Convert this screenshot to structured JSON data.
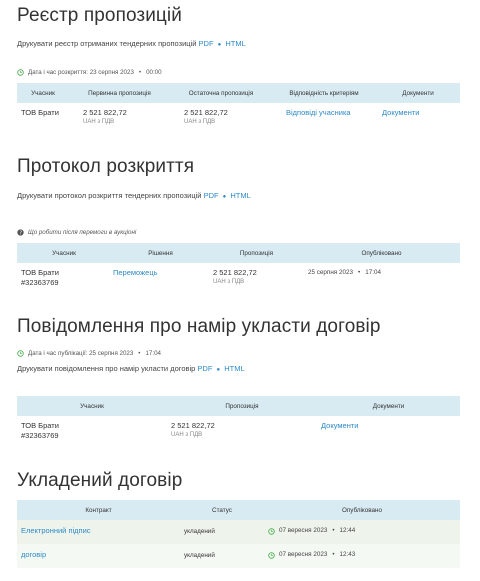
{
  "registry": {
    "title": "Реєстр пропозицій",
    "print_text": "Друкувати реєстр отриманих тендерних пропозицій",
    "pdf": "PDF",
    "html": "HTML",
    "opened_label": "Дата і час розкриття: 23 серпня 2023",
    "opened_time": "00:00",
    "columns": [
      "Учасник",
      "Первинна пропозиція",
      "Остаточна пропозиція",
      "Відповідність критеріям",
      "Документи"
    ],
    "rows": [
      {
        "participant": "ТОВ Брати",
        "initial": "2 521 822,72",
        "initial_sub": "UAH з ПДВ",
        "final": "2 521 822,72",
        "final_sub": "UAH з ПДВ",
        "criteria": "Відповіді учасника",
        "docs": "Документи"
      }
    ]
  },
  "protocol": {
    "title": "Протокол розкриття",
    "print_text": "Друкувати протокол розкриття тендерних пропозицій",
    "pdf": "PDF",
    "html": "HTML",
    "help_text": "Що робити після перемоги в аукціоні",
    "columns": [
      "Учасник",
      "Рішення",
      "Пропозиція",
      "Опубліковано"
    ],
    "rows": [
      {
        "participant": "ТОВ Брати",
        "participant_id": "#32363769",
        "decision": "Переможець",
        "offer": "2 521 822,72",
        "offer_sub": "UAH з ПДВ",
        "published_date": "25 серпня 2023",
        "published_time": "17:04"
      }
    ]
  },
  "intent": {
    "title": "Повідомлення про намір укласти договір",
    "pub_label": "Дата і час публікації: 25 серпня 2023",
    "pub_time": "17:04",
    "print_text": "Друкувати повідомлення про намір укласти договір",
    "pdf": "PDF",
    "html": "HTML",
    "columns": [
      "Учасник",
      "Пропозиція",
      "Документи"
    ],
    "rows": [
      {
        "participant": "ТОВ Брати",
        "participant_id": "#32363769",
        "offer": "2 521 822,72",
        "offer_sub": "UAH з ПДВ",
        "docs": "Документи"
      }
    ]
  },
  "contract": {
    "title": "Укладений договір",
    "columns": [
      "Контракт",
      "Статус",
      "Опубліковано"
    ],
    "rows": [
      {
        "contract": "Електронний підпис",
        "status": "укладений",
        "date": "07 вересня 2023",
        "time": "12:44"
      },
      {
        "contract": "договір",
        "status": "укладений",
        "date": "07 вересня 2023",
        "time": "12:43"
      }
    ]
  },
  "colors": {
    "accent": "#2d8ac7",
    "header_bg": "#d8eaf2",
    "clock": "#4caf50"
  }
}
